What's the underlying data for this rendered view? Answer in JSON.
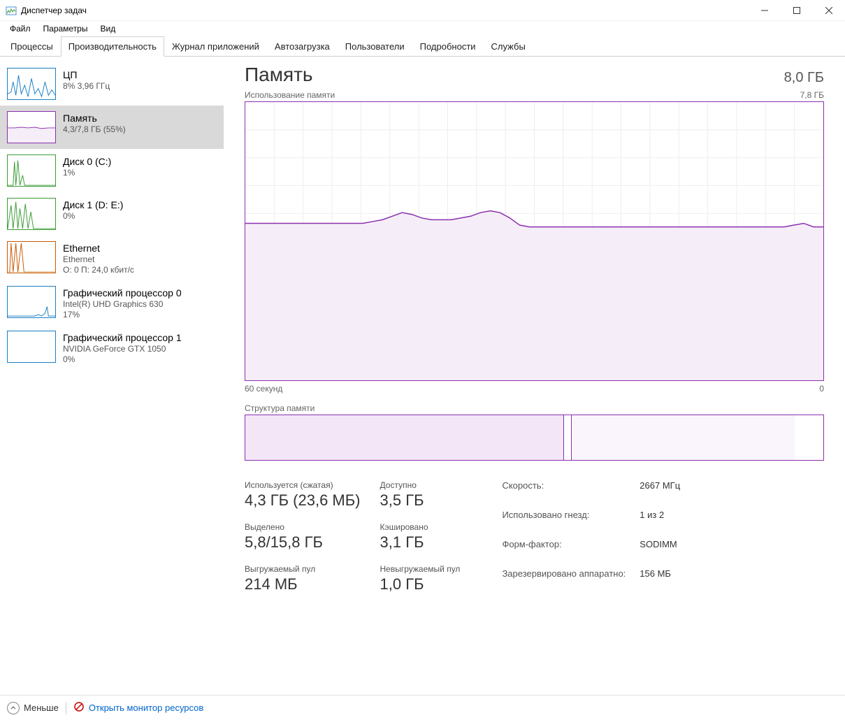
{
  "window": {
    "title": "Диспетчер задач"
  },
  "menu": {
    "file": "Файл",
    "options": "Параметры",
    "view": "Вид"
  },
  "tabs": {
    "processes": "Процессы",
    "performance": "Производительность",
    "app_history": "Журнал приложений",
    "startup": "Автозагрузка",
    "users": "Пользователи",
    "details": "Подробности",
    "services": "Службы"
  },
  "sidebar": {
    "cpu": {
      "title": "ЦП",
      "sub": "8% 3,96 ГГц",
      "color": "#1a7fc4"
    },
    "memory": {
      "title": "Память",
      "sub": "4,3/7,8 ГБ (55%)",
      "color": "#8b2fb0"
    },
    "disk0": {
      "title": "Диск 0 (C:)",
      "sub": "1%",
      "color": "#3a9b35"
    },
    "disk1": {
      "title": "Диск 1 (D: E:)",
      "sub": "0%",
      "color": "#3a9b35"
    },
    "ethernet": {
      "title": "Ethernet",
      "sub1": "Ethernet",
      "sub2": "О: 0 П: 24,0 кбит/с",
      "color": "#c85a00"
    },
    "gpu0": {
      "title": "Графический процессор 0",
      "sub1": "Intel(R) UHD Graphics 630",
      "sub2": "17%",
      "color": "#1a7fc4"
    },
    "gpu1": {
      "title": "Графический процессор 1",
      "sub1": "NVIDIA GeForce GTX 1050",
      "sub2": "0%",
      "color": "#1a7fc4"
    }
  },
  "main": {
    "title": "Память",
    "capacity": "8,0 ГБ",
    "chart_label_left": "Использование памяти",
    "chart_label_right": "7,8 ГБ",
    "axis_left": "60 секунд",
    "axis_right": "0",
    "comp_label": "Структура памяти"
  },
  "stats": {
    "used_label": "Используется (сжатая)",
    "used_value": "4,3 ГБ (23,6 МБ)",
    "avail_label": "Доступно",
    "avail_value": "3,5 ГБ",
    "commit_label": "Выделено",
    "commit_value": "5,8/15,8 ГБ",
    "cached_label": "Кэшировано",
    "cached_value": "3,1 ГБ",
    "paged_label": "Выгружаемый пул",
    "paged_value": "214 МБ",
    "nonpaged_label": "Невыгружаемый пул",
    "nonpaged_value": "1,0 ГБ"
  },
  "specs": {
    "speed_label": "Скорость:",
    "speed_value": "2667 МГц",
    "slots_label": "Использовано гнезд:",
    "slots_value": "1 из 2",
    "form_label": "Форм-фактор:",
    "form_value": "SODIMM",
    "reserved_label": "Зарезервировано аппаратно:",
    "reserved_value": "156 МБ"
  },
  "footer": {
    "less": "Меньше",
    "monitor": "Открыть монитор ресурсов"
  },
  "comp_segments": [
    {
      "pct": 55,
      "bg": "#f2e6f7"
    },
    {
      "pct": 1.5,
      "bg": "#ffffff",
      "border": true
    },
    {
      "pct": 38.5,
      "bg": "#faf5fc"
    },
    {
      "pct": 5,
      "bg": "#ffffff"
    }
  ],
  "chart_data": {
    "type": "area",
    "title": "Использование памяти",
    "ylabel": "ГБ",
    "ylim": [
      0,
      7.8
    ],
    "xlim_seconds": [
      60,
      0
    ],
    "series": [
      {
        "name": "Память",
        "color": "#8b2fb0",
        "fill": "#f5eef8",
        "values_gb": [
          4.4,
          4.4,
          4.4,
          4.4,
          4.4,
          4.4,
          4.4,
          4.4,
          4.4,
          4.4,
          4.4,
          4.4,
          4.4,
          4.45,
          4.5,
          4.6,
          4.7,
          4.65,
          4.55,
          4.5,
          4.5,
          4.5,
          4.55,
          4.6,
          4.7,
          4.75,
          4.7,
          4.55,
          4.35,
          4.3,
          4.3,
          4.3,
          4.3,
          4.3,
          4.3,
          4.3,
          4.3,
          4.3,
          4.3,
          4.3,
          4.3,
          4.3,
          4.3,
          4.3,
          4.3,
          4.3,
          4.3,
          4.3,
          4.3,
          4.3,
          4.3,
          4.3,
          4.3,
          4.3,
          4.3,
          4.3,
          4.35,
          4.4,
          4.3,
          4.3
        ]
      }
    ]
  }
}
